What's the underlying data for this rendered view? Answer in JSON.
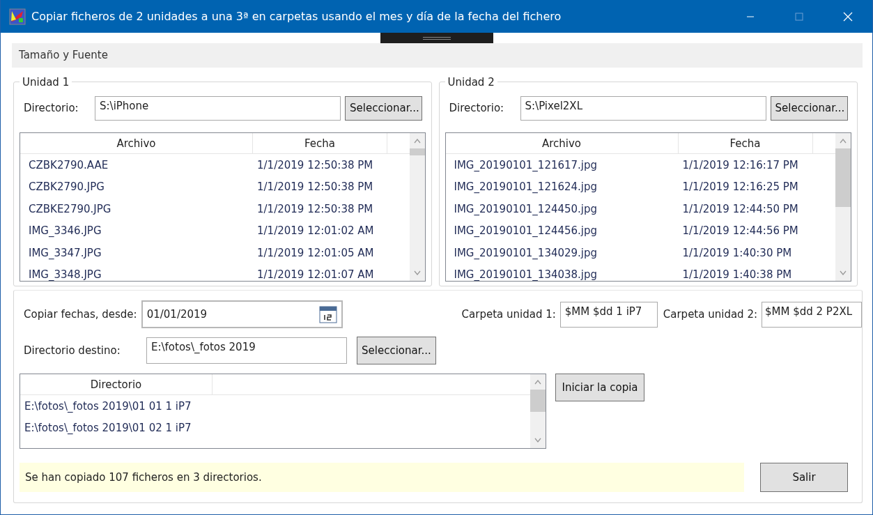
{
  "window": {
    "title": "Copiar ficheros de 2 unidades a una 3ª en carpetas usando el mes y día de la fecha del fichero"
  },
  "menu": [
    {
      "label": "Tamaño y Fuente"
    }
  ],
  "units": [
    {
      "title": "Unidad 1",
      "dir_label": "Directorio:",
      "dir_value": "S:\\iPhone",
      "button": "Seleccionar...",
      "columns": [
        "Archivo",
        "Fecha"
      ],
      "rows": [
        {
          "file": "CZBK2790.AAE",
          "date": "1/1/2019 12:50:38 PM"
        },
        {
          "file": "CZBK2790.JPG",
          "date": "1/1/2019 12:50:38 PM"
        },
        {
          "file": "CZBKE2790.JPG",
          "date": "1/1/2019 12:50:38 PM"
        },
        {
          "file": "IMG_3346.JPG",
          "date": "1/1/2019 12:01:02 AM"
        },
        {
          "file": "IMG_3347.JPG",
          "date": "1/1/2019 12:01:05 AM"
        },
        {
          "file": "IMG_3348.JPG",
          "date": "1/1/2019 12:01:07 AM"
        }
      ]
    },
    {
      "title": "Unidad 2",
      "dir_label": "Directorio:",
      "dir_value": "S:\\Pixel2XL",
      "button": "Seleccionar...",
      "columns": [
        "Archivo",
        "Fecha"
      ],
      "rows": [
        {
          "file": "IMG_20190101_121617.jpg",
          "date": "1/1/2019 12:16:17 PM"
        },
        {
          "file": "IMG_20190101_121624.jpg",
          "date": "1/1/2019 12:16:25 PM"
        },
        {
          "file": "IMG_20190101_124450.jpg",
          "date": "1/1/2019 12:44:50 PM"
        },
        {
          "file": "IMG_20190101_124456.jpg",
          "date": "1/1/2019 12:44:56 PM"
        },
        {
          "file": "IMG_20190101_134029.jpg",
          "date": "1/1/2019 1:40:30 PM"
        },
        {
          "file": "IMG_20190101_134038.jpg",
          "date": "1/1/2019 1:40:38 PM"
        }
      ]
    }
  ],
  "copy": {
    "date_label": "Copiar fechas, desde:",
    "date_value": "01/01/2019",
    "dest_label": "Directorio destino:",
    "dest_value": "E:\\fotos\\_fotos 2019",
    "dest_button": "Seleccionar...",
    "folder1_label": "Carpeta unidad 1:",
    "folder1_value": "$MM $dd 1 iP7",
    "folder2_label": "Carpeta unidad 2:",
    "folder2_value": "$MM $dd 2 P2XL",
    "dir_column": "Directorio",
    "dirs": [
      "E:\\fotos\\_fotos 2019\\01 01 1 iP7",
      "E:\\fotos\\_fotos 2019\\01 02 1 iP7"
    ],
    "start_button": "Iniciar la copia"
  },
  "status": "Se han copiado 107 ficheros en 3 directorios.",
  "exit_button": "Salir"
}
